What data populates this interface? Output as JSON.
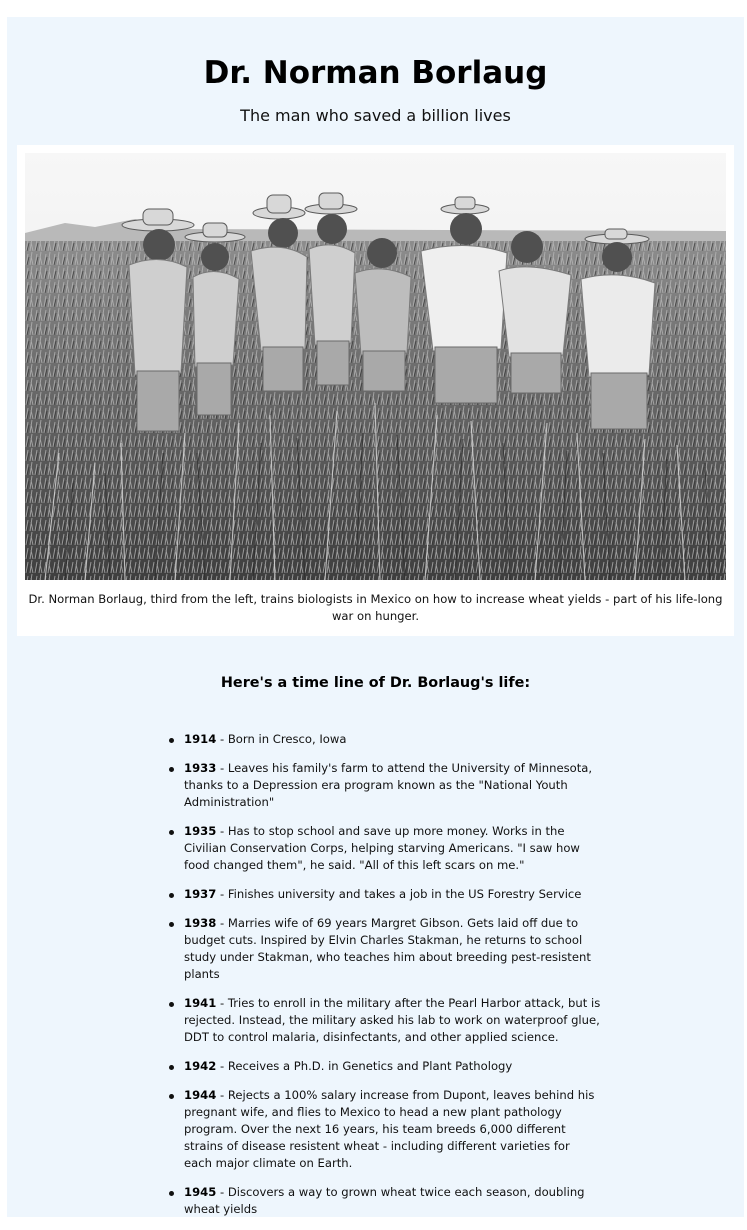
{
  "title": "Dr. Norman Borlaug",
  "subtitle": "The man who saved a billion lives",
  "image": {
    "alt": "Dr. Norman Borlaug, third from the left, trains biologists in Mexico on how to increase wheat yields - part of his life-long war on hunger.",
    "caption": "Dr. Norman Borlaug, third from the left, trains biologists in Mexico on how to increase wheat yields - part of his life-long war on hunger."
  },
  "timeline_heading": "Here's a time line of Dr. Borlaug's life:",
  "timeline": [
    {
      "year": "1914",
      "text": " - Born in Cresco, Iowa"
    },
    {
      "year": "1933",
      "text": " - Leaves his family's farm to attend the University of Minnesota, thanks to a Depression era program known as the \"National Youth Administration\""
    },
    {
      "year": "1935",
      "text": " - Has to stop school and save up more money. Works in the Civilian Conservation Corps, helping starving Americans. \"I saw how food changed them\", he said. \"All of this left scars on me.\""
    },
    {
      "year": "1937",
      "text": " - Finishes university and takes a job in the US Forestry Service"
    },
    {
      "year": "1938",
      "text": " - Marries wife of 69 years Margret Gibson. Gets laid off due to budget cuts. Inspired by Elvin Charles Stakman, he returns to school study under Stakman, who teaches him about breeding pest-resistent plants"
    },
    {
      "year": "1941",
      "text": " - Tries to enroll in the military after the Pearl Harbor attack, but is rejected. Instead, the military asked his lab to work on waterproof glue, DDT to control malaria, disinfectants, and other applied science."
    },
    {
      "year": "1942",
      "text": " - Receives a Ph.D. in Genetics and Plant Pathology"
    },
    {
      "year": "1944",
      "text": " - Rejects a 100% salary increase from Dupont, leaves behind his pregnant wife, and flies to Mexico to head a new plant pathology program. Over the next 16 years, his team breeds 6,000 different strains of disease resistent wheat - including different varieties for each major climate on Earth."
    },
    {
      "year": "1945",
      "text": " - Discovers a way to grown wheat twice each season, doubling wheat yields"
    }
  ]
}
